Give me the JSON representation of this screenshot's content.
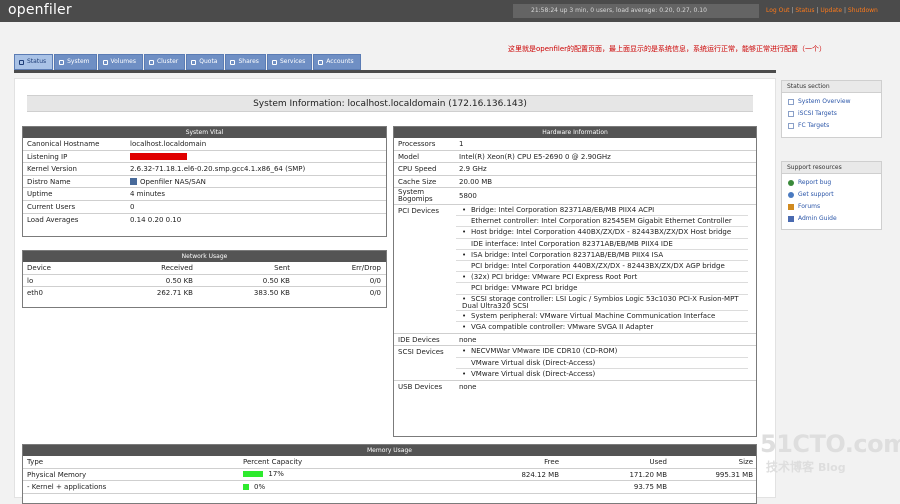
{
  "header": {
    "logo": "openfiler",
    "uptime": "21:58:24 up 3 min, 0 users, load average: 0.20, 0.27, 0.10",
    "links": [
      "Log Out",
      "Status",
      "Update",
      "Shutdown"
    ]
  },
  "note": "这里就是openfiler的配置页面，最上面显示的是系统信息，系统运行正常，能够正常进行配置（一个）",
  "tabs": [
    "Status",
    "System",
    "Volumes",
    "Cluster",
    "Quota",
    "Shares",
    "Services",
    "Accounts"
  ],
  "active_tab": "Status",
  "title": "System Information: localhost.localdomain (172.16.136.143)",
  "system_vital": {
    "heading": "System Vital",
    "rows": [
      {
        "label": "Canonical Hostname",
        "value": "localhost.localdomain"
      },
      {
        "label": "Listening IP",
        "value": ""
      },
      {
        "label": "Kernel Version",
        "value": "2.6.32-71.18.1.el6-0.20.smp.gcc4.1.x86_64 (SMP)"
      },
      {
        "label": "Distro Name",
        "value": "Openfiler NAS/SAN"
      },
      {
        "label": "Uptime",
        "value": "4 minutes"
      },
      {
        "label": "Current Users",
        "value": "0"
      },
      {
        "label": "Load Averages",
        "value": "0.14 0.20 0.10"
      }
    ]
  },
  "network_usage": {
    "heading": "Network Usage",
    "columns": [
      "Device",
      "Received",
      "Sent",
      "Err/Drop"
    ],
    "rows": [
      [
        "lo",
        "0.50 KB",
        "0.50 KB",
        "0/0"
      ],
      [
        "eth0",
        "262.71 KB",
        "383.50 KB",
        "0/0"
      ]
    ]
  },
  "hardware": {
    "heading": "Hardware Information",
    "rows": [
      {
        "label": "Processors",
        "value": "1"
      },
      {
        "label": "Model",
        "value": "Intel(R) Xeon(R) CPU E5-2690 0 @ 2.90GHz"
      },
      {
        "label": "CPU Speed",
        "value": "2.9 GHz"
      },
      {
        "label": "Cache Size",
        "value": "20.00 MB"
      },
      {
        "label": "System Bogomips",
        "value": "5800"
      }
    ],
    "pci_label": "PCI Devices",
    "pci": [
      "Bridge: Intel Corporation 82371AB/EB/MB PIIX4 ACPI",
      "Ethernet controller: Intel Corporation 82545EM Gigabit Ethernet Controller",
      "Host bridge: Intel Corporation 440BX/ZX/DX - 82443BX/ZX/DX Host bridge",
      "IDE interface: Intel Corporation 82371AB/EB/MB PIIX4 IDE",
      "ISA bridge: Intel Corporation 82371AB/EB/MB PIIX4 ISA",
      "PCI bridge: Intel Corporation 440BX/ZX/DX - 82443BX/ZX/DX AGP bridge",
      "(32x) PCI bridge: VMware PCI Express Root Port",
      "PCI bridge: VMware PCI bridge",
      "SCSI storage controller: LSI Logic / Symbios Logic 53c1030 PCI-X Fusion-MPT Dual Ultra320 SCSI",
      "System peripheral: VMware Virtual Machine Communication Interface",
      "VGA compatible controller: VMware SVGA II Adapter"
    ],
    "ide_label": "IDE Devices",
    "ide": "none",
    "scsi_label": "SCSI Devices",
    "scsi": [
      "NECVMWar VMware IDE CDR10 (CD-ROM)",
      "VMware Virtual disk (Direct-Access)",
      "VMware Virtual disk (Direct-Access)"
    ],
    "usb_label": "USB Devices",
    "usb": "none"
  },
  "memory": {
    "heading": "Memory Usage",
    "columns": [
      "Type",
      "Percent Capacity",
      "Free",
      "Used",
      "Size"
    ],
    "rows": [
      {
        "type": "Physical Memory",
        "percent": "17%",
        "free": "824.12 MB",
        "used": "171.20 MB",
        "size": "995.31 MB"
      },
      {
        "type": "- Kernel + applications",
        "percent": "0%",
        "free": "",
        "used": "93.75 MB",
        "size": ""
      }
    ]
  },
  "status_section": {
    "heading": "Status section",
    "items": [
      "System Overview",
      "iSCSI Targets",
      "FC Targets"
    ]
  },
  "support_section": {
    "heading": "Support resources",
    "items": [
      "Report bug",
      "Get support",
      "Forums",
      "Admin Guide"
    ]
  },
  "watermark": [
    "51CTO.com",
    "技术博客",
    "Blog"
  ],
  "colors": {
    "topbar": "#4b4b4b",
    "tab": "#6f8fc4",
    "panel_header": "#545454",
    "link": "#2a55a8",
    "accent": "#ff7a1a",
    "bar": "#2eea2e",
    "redact": "#e00000"
  }
}
